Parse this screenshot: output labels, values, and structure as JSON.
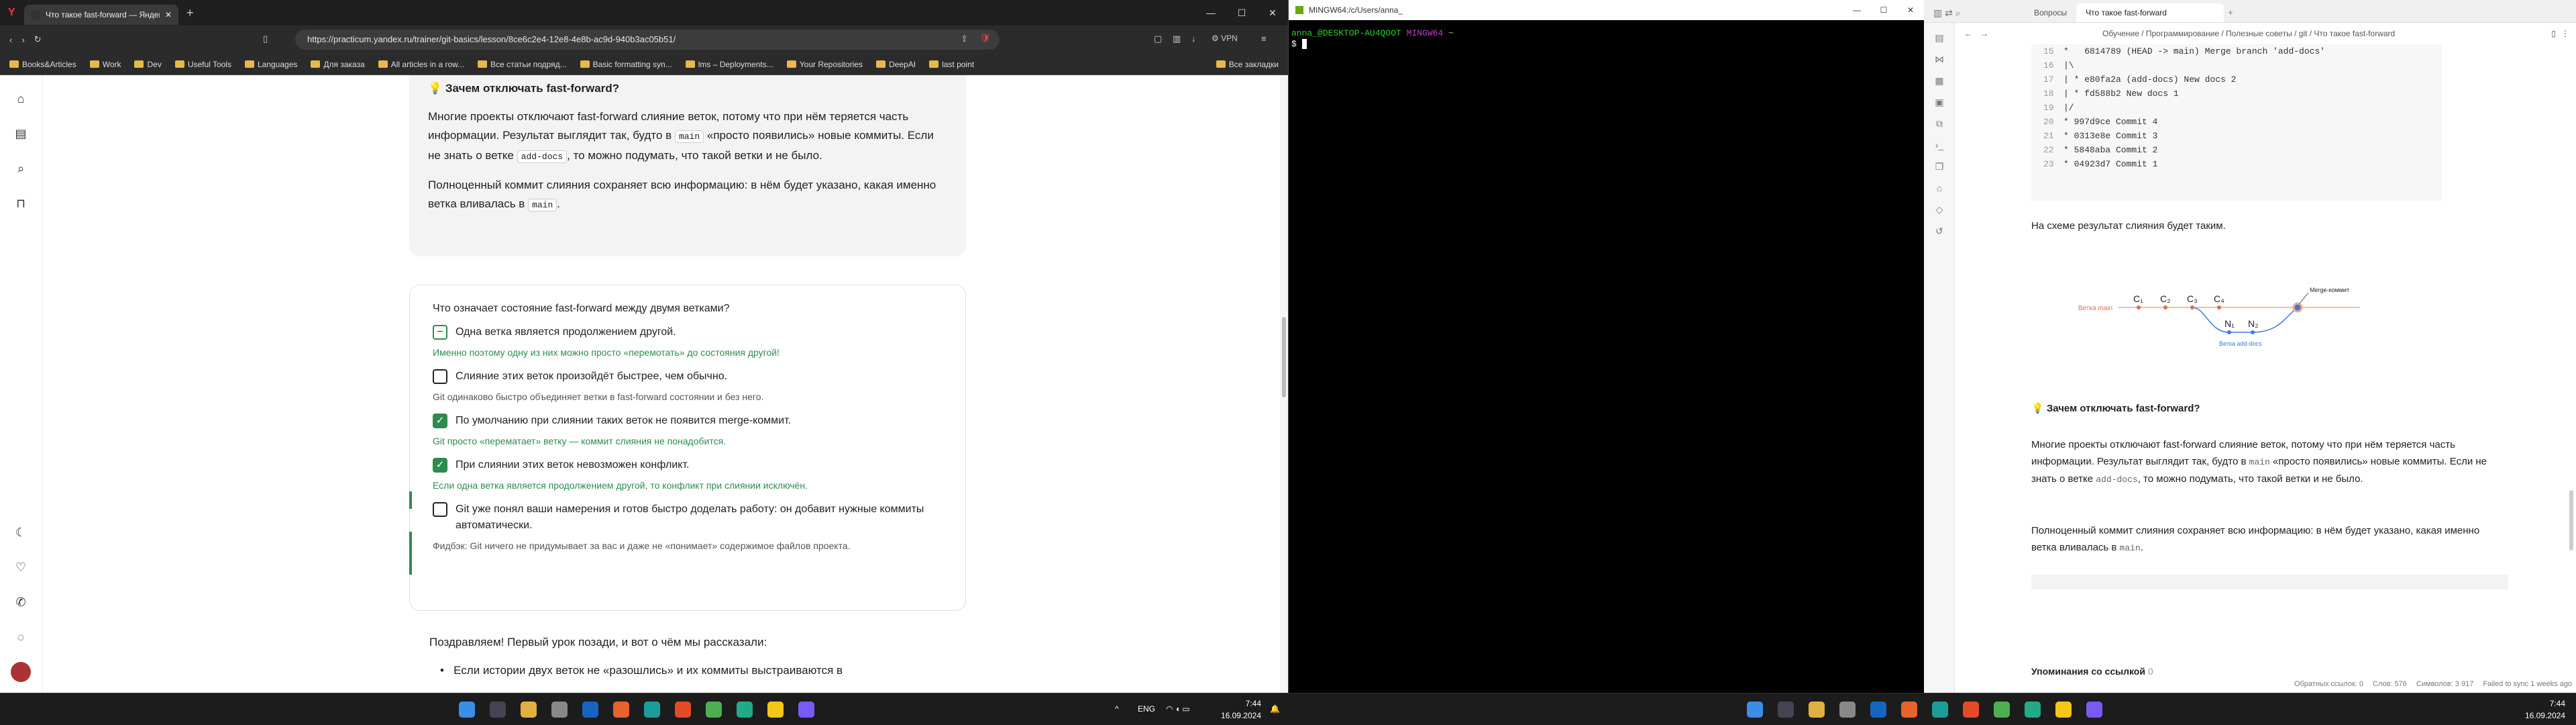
{
  "browser": {
    "tab_title": "Что такое fast-forward — Яндекс",
    "url": "https://practicum.yandex.ru/trainer/git-basics/lesson/8ce6c2e4-12e8-4e8b-ac9d-940b3ac05b51/",
    "vpn": "VPN",
    "bookmarks": [
      "Books&Articles",
      "Work",
      "Dev",
      "Useful Tools",
      "Languages",
      "Для заказа",
      "All articles in a row...",
      "Все статьи подряд...",
      "Basic formatting syn...",
      "lms – Deployments...",
      "Your Repositories",
      "DeepAI",
      "last point"
    ],
    "bookmarks_right": "Все закладки"
  },
  "note": {
    "title": "💡 Зачем отключать fast-forward?",
    "p1a": "Многие проекты отключают fast-forward слияние веток, потому что при нём теряется часть информации. Результат выглядит так, будто в ",
    "code_main": "main",
    "p1b": " «просто появились» новые коммиты. Если не знать о ветке ",
    "code_add": "add-docs",
    "p1c": ", то можно подумать, что такой ветки и не было.",
    "p2a": "Полноценный коммит слияния сохраняет всю информацию: в нём будет указано, какая именно ветка вливалась в ",
    "p2b": "."
  },
  "quiz": {
    "question": "Что означает состояние fast-forward между двумя ветками?",
    "options": [
      {
        "label": "Одна ветка является продолжением другой.",
        "hint": "Именно поэтому одну из них можно просто «перемотать» до состояния другой!",
        "state": "partial",
        "hint_color": "green"
      },
      {
        "label": "Слияние этих веток произойдёт быстрее, чем обычно.",
        "hint": "Git одинаково быстро объединяет ветки в fast-forward состоянии и без него.",
        "state": "off",
        "hint_color": "neutral"
      },
      {
        "label": "По умолчанию при слиянии таких веток не появится merge-коммит.",
        "hint": "Git просто «перематает» ветку — коммит слияния не понадобится.",
        "state": "on",
        "hint_color": "green"
      },
      {
        "label": "При слиянии этих веток невозможен конфликт.",
        "hint": "Если одна ветка является продолжением другой, то конфликт при слиянии исключён.",
        "state": "on",
        "hint_color": "green"
      },
      {
        "label": "Git уже понял ваши намерения и готов быстро доделать работу: он добавит нужные коммиты автоматически.",
        "hint": "Фидбэк: Git ничего не придумывает за вас и даже не «понимает» содержимое файлов проекта.",
        "state": "off",
        "hint_color": "neutral"
      }
    ]
  },
  "after": {
    "congrats": "Поздравляем! Первый урок позади, и вот о чём мы рассказали:",
    "bullet": "Если истории двух веток не «разошлись» и их коммиты выстраиваются в"
  },
  "terminal": {
    "title": "MINGW64:/c/Users/anna_",
    "prompt_user": "anna_@DESKTOP-AU4QOOT",
    "prompt_env": "MINGW64",
    "prompt_dir": "~",
    "prompt_symbol": "$"
  },
  "obsidian": {
    "tabs": [
      "Вопросы",
      "Что такое fast-forward"
    ],
    "breadcrumb": "Обучение / Программирование / Полезные советы / git / Что такое fast-forward",
    "code_lines": [
      {
        "n": "15",
        "t": "*   6814789 (HEAD -> main) Merge branch 'add-docs'"
      },
      {
        "n": "16",
        "t": "|\\"
      },
      {
        "n": "17",
        "t": "| * e80fa2a (add-docs) New docs 2"
      },
      {
        "n": "18",
        "t": "| * fd588b2 New docs 1"
      },
      {
        "n": "19",
        "t": "|/"
      },
      {
        "n": "20",
        "t": "* 997d9ce Commit 4"
      },
      {
        "n": "21",
        "t": "* 0313e8e Commit 3"
      },
      {
        "n": "22",
        "t": "* 5848aba Commit 2"
      },
      {
        "n": "23",
        "t": "* 04923d7 Commit 1"
      }
    ],
    "scheme_text": "На схеме результат слияния будет таким.",
    "diagram": {
      "main_label": "Ветка main",
      "add_label": "Ветка add-docs",
      "merge_label": "Merge-коммит",
      "commits": [
        "C₁",
        "C₂",
        "C₃",
        "C₄"
      ],
      "add_commits": [
        "N₁",
        "N₂"
      ]
    },
    "heading": "💡 Зачем отключать fast-forward?",
    "p1a": "Многие проекты отключают fast-forward слияние веток, потому что при нём теряется часть информации. Результат выглядит так, будто в ",
    "p1code": "main",
    "p1b": " «просто появились» новые коммиты. Если не знать о ветке ",
    "p1code2": "add-docs",
    "p1c": ", то можно подумать, что такой ветки и не было.",
    "p2a": "Полноценный коммит слияния сохраняет всю информацию: в нём будет указано, какая именно ветка вливалась в ",
    "p2code": "main",
    "p2b": ".",
    "mentions": "Упоминания со ссылкой",
    "mentions_count": "0",
    "status": [
      "Обратных ссылок: 0",
      "Слов: 576",
      "Символов: 3 917",
      "Failed to sync 1 weeks ago"
    ]
  },
  "taskbar": {
    "lang": "ENG",
    "time": "7:44",
    "date": "16.09.2024"
  }
}
